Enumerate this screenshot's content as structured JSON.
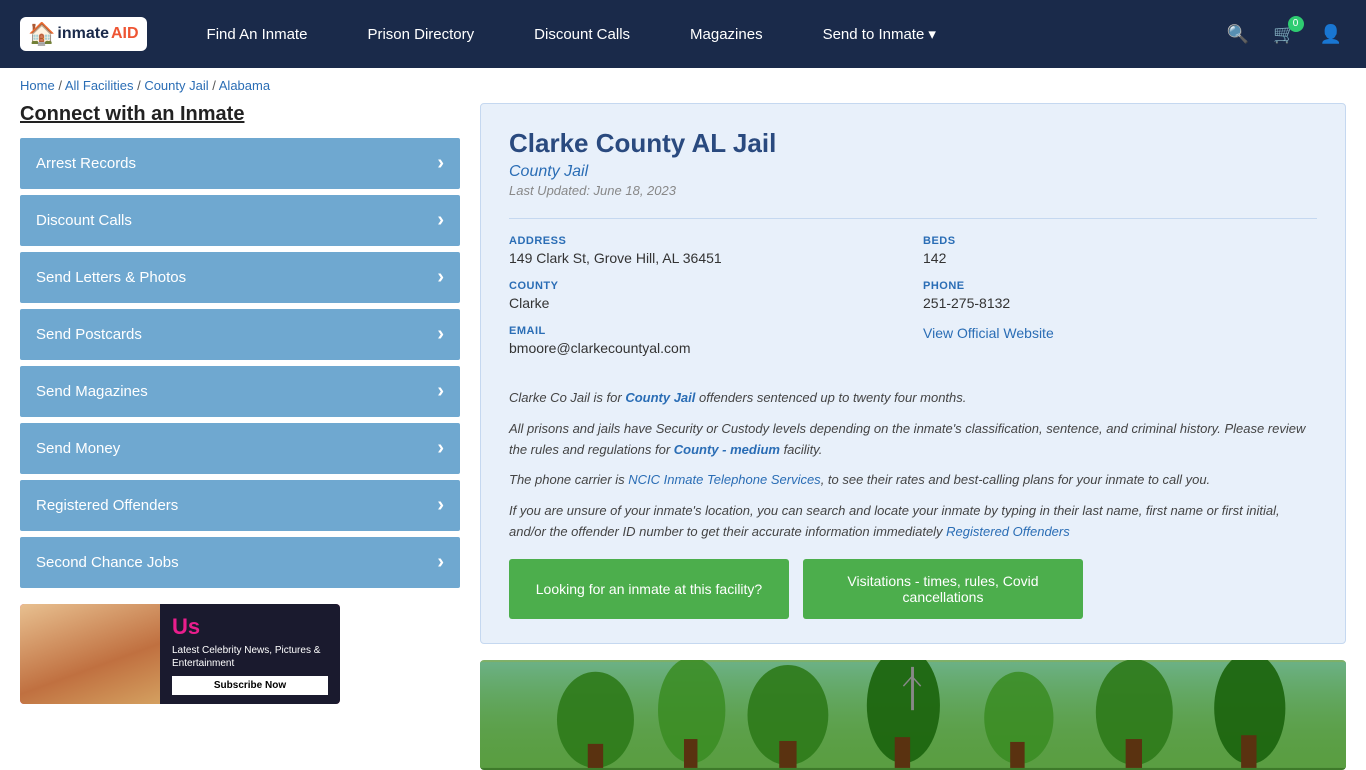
{
  "navbar": {
    "logo_text": "inmateAID",
    "nav_items": [
      {
        "id": "find-inmate",
        "label": "Find An Inmate"
      },
      {
        "id": "prison-directory",
        "label": "Prison Directory"
      },
      {
        "id": "discount-calls",
        "label": "Discount Calls"
      },
      {
        "id": "magazines",
        "label": "Magazines"
      },
      {
        "id": "send-to-inmate",
        "label": "Send to Inmate"
      }
    ],
    "cart_count": "0",
    "send_dropdown_arrow": "▾"
  },
  "breadcrumb": {
    "items": [
      {
        "label": "Home",
        "href": "#"
      },
      {
        "label": "All Facilities",
        "href": "#"
      },
      {
        "label": "County Jail",
        "href": "#"
      },
      {
        "label": "Alabama",
        "href": "#"
      }
    ]
  },
  "sidebar": {
    "title": "Connect with an Inmate",
    "buttons": [
      {
        "id": "arrest-records",
        "label": "Arrest Records"
      },
      {
        "id": "discount-calls",
        "label": "Discount Calls"
      },
      {
        "id": "send-letters-photos",
        "label": "Send Letters & Photos"
      },
      {
        "id": "send-postcards",
        "label": "Send Postcards"
      },
      {
        "id": "send-magazines",
        "label": "Send Magazines"
      },
      {
        "id": "send-money",
        "label": "Send Money"
      },
      {
        "id": "registered-offenders",
        "label": "Registered Offenders"
      },
      {
        "id": "second-chance-jobs",
        "label": "Second Chance Jobs"
      }
    ],
    "ad": {
      "brand": "Us",
      "title": "Latest Celebrity News, Pictures & Entertainment",
      "cta": "Subscribe Now"
    }
  },
  "facility": {
    "name": "Clarke County AL Jail",
    "type": "County Jail",
    "last_updated": "Last Updated: June 18, 2023",
    "address_label": "ADDRESS",
    "address_value": "149 Clark St, Grove Hill, AL 36451",
    "beds_label": "BEDS",
    "beds_value": "142",
    "county_label": "COUNTY",
    "county_value": "Clarke",
    "phone_label": "PHONE",
    "phone_value": "251-275-8132",
    "email_label": "EMAIL",
    "email_value": "bmoore@clarkecountyal.com",
    "website_link": "View Official Website",
    "desc1": "Clarke Co Jail is for County Jail offenders sentenced up to twenty four months.",
    "desc2": "All prisons and jails have Security or Custody levels depending on the inmate's classification, sentence, and criminal history. Please review the rules and regulations for County - medium facility.",
    "desc3": "The phone carrier is NCIC Inmate Telephone Services, to see their rates and best-calling plans for your inmate to call you.",
    "desc4": "If you are unsure of your inmate's location, you can search and locate your inmate by typing in their last name, first name or first initial, and/or the offender ID number to get their accurate information immediately Registered Offenders",
    "btn1": "Looking for an inmate at this facility?",
    "btn2": "Visitations - times, rules, Covid cancellations"
  }
}
